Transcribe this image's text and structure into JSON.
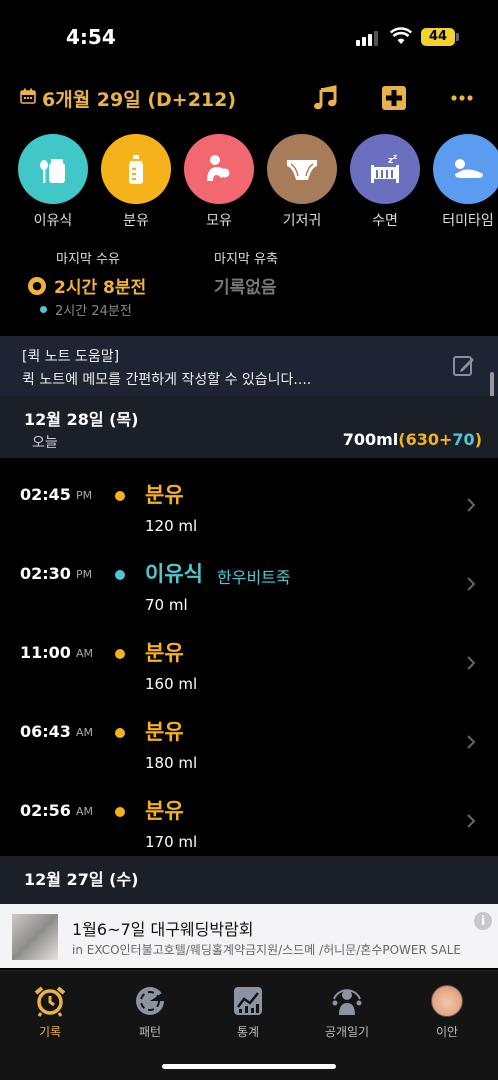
{
  "status": {
    "time": "4:54",
    "battery": "44"
  },
  "header": {
    "date": "6개월 29일 (D+212)"
  },
  "categories": [
    {
      "label": "이유식",
      "color": "#41c7c7",
      "icon": "baby-food-icon"
    },
    {
      "label": "분유",
      "color": "#f5b21a",
      "icon": "bottle-icon"
    },
    {
      "label": "모유",
      "color": "#f26870",
      "icon": "breastfeeding-icon"
    },
    {
      "label": "기저귀",
      "color": "#a77c5a",
      "icon": "diaper-icon"
    },
    {
      "label": "수면",
      "color": "#6a6fc0",
      "icon": "sleep-icon"
    },
    {
      "label": "터미타임",
      "color": "#5b9cf0",
      "icon": "tummy-time-icon"
    }
  ],
  "last": {
    "feed_label": "마지막 수유",
    "feed_value": "2시간 8분전",
    "feed_icon": "💧",
    "pump_label": "마지막 유축",
    "pump_value": "기록없음",
    "sub_value": "2시간 24분전"
  },
  "note": {
    "title": "[퀵 노트 도움말]",
    "text": "퀵 노트에 메모를 간편하게 작성할 수 있습니다...."
  },
  "day1": {
    "date": "12월 28일 (목)",
    "sub": "오늘",
    "total_main": "700ml",
    "total_open": "(",
    "total_a": "630",
    "total_plus": "+",
    "total_b": "70",
    "total_close": ")"
  },
  "entries": [
    {
      "time": "02:45",
      "ampm": "PM",
      "name": "분유",
      "extra": "",
      "amount": "120 ml",
      "color": "#f5b21a"
    },
    {
      "time": "02:30",
      "ampm": "PM",
      "name": "이유식",
      "extra": "한우비트죽",
      "amount": "70 ml",
      "color": "#4fc7d1"
    },
    {
      "time": "11:00",
      "ampm": "AM",
      "name": "분유",
      "extra": "",
      "amount": "160 ml",
      "color": "#f5b21a"
    },
    {
      "time": "06:43",
      "ampm": "AM",
      "name": "분유",
      "extra": "",
      "amount": "180 ml",
      "color": "#f5b21a"
    },
    {
      "time": "02:56",
      "ampm": "AM",
      "name": "분유",
      "extra": "",
      "amount": "170 ml",
      "color": "#f5b21a"
    }
  ],
  "day2": {
    "date": "12월 27일 (수)"
  },
  "ad": {
    "title": "1월6~7일 대구웨딩박람회",
    "desc": "in EXCO인터불고호텔/웨딩홀계약금지원/스드메 /허니문/혼수POWER SALE",
    "info": "i"
  },
  "tabs": [
    {
      "label": "기록",
      "icon": "alarm-clock-icon",
      "active": true
    },
    {
      "label": "패턴",
      "icon": "pattern-icon",
      "active": false
    },
    {
      "label": "통계",
      "icon": "stats-icon",
      "active": false
    },
    {
      "label": "공개일기",
      "icon": "public-diary-icon",
      "active": false
    },
    {
      "label": "이안",
      "icon": "baby-avatar",
      "active": false
    }
  ]
}
